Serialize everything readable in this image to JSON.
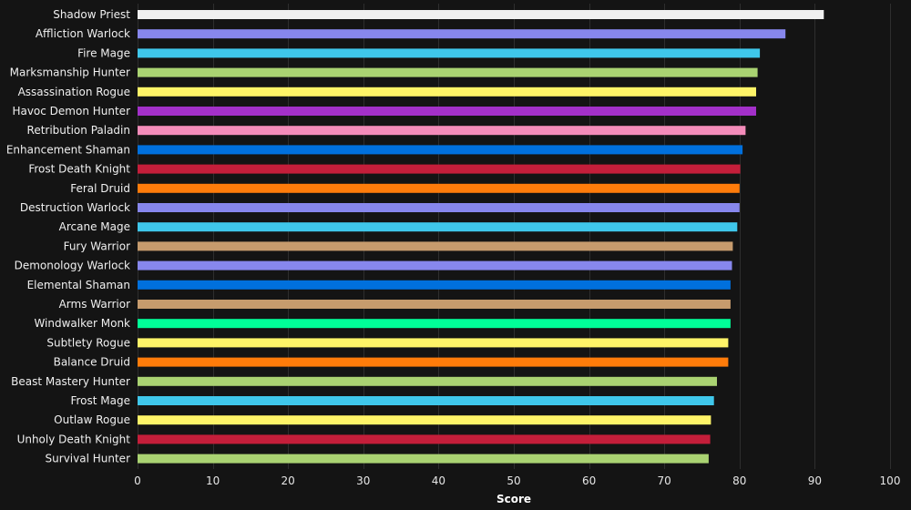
{
  "chart_data": {
    "type": "bar",
    "orientation": "horizontal",
    "title": "",
    "xlabel": "Score",
    "ylabel": "",
    "xlim": [
      0,
      100
    ],
    "ticks": [
      0,
      10,
      20,
      30,
      40,
      50,
      60,
      70,
      80,
      90,
      100
    ],
    "grid": true,
    "background": "#141414",
    "categories": [
      "Shadow Priest",
      "Affliction Warlock",
      "Fire Mage",
      "Marksmanship Hunter",
      "Assassination Rogue",
      "Havoc Demon Hunter",
      "Retribution Paladin",
      "Enhancement Shaman",
      "Frost Death Knight",
      "Feral Druid",
      "Destruction Warlock",
      "Arcane Mage",
      "Fury Warrior",
      "Demonology Warlock",
      "Elemental Shaman",
      "Arms Warrior",
      "Windwalker Monk",
      "Subtlety Rogue",
      "Balance Druid",
      "Beast Mastery Hunter",
      "Frost Mage",
      "Outlaw Rogue",
      "Unholy Death Knight",
      "Survival Hunter"
    ],
    "values": [
      91.2,
      86.1,
      82.7,
      82.4,
      82.2,
      82.2,
      80.8,
      80.4,
      80.1,
      80.0,
      80.0,
      79.7,
      79.1,
      79.0,
      78.8,
      78.8,
      78.8,
      78.5,
      78.5,
      77.0,
      76.6,
      76.2,
      76.1,
      75.9
    ],
    "colors": [
      "#f0f0f0",
      "#8787ed",
      "#3fc7eb",
      "#aad372",
      "#fff468",
      "#a330c9",
      "#f48cba",
      "#0070dd",
      "#c41e3a",
      "#ff7c0a",
      "#8787ed",
      "#3fc7eb",
      "#c69b6d",
      "#8787ed",
      "#0070dd",
      "#c69b6d",
      "#00ff98",
      "#fff468",
      "#ff7c0a",
      "#aad372",
      "#3fc7eb",
      "#fff468",
      "#c41e3a",
      "#aad372"
    ]
  }
}
